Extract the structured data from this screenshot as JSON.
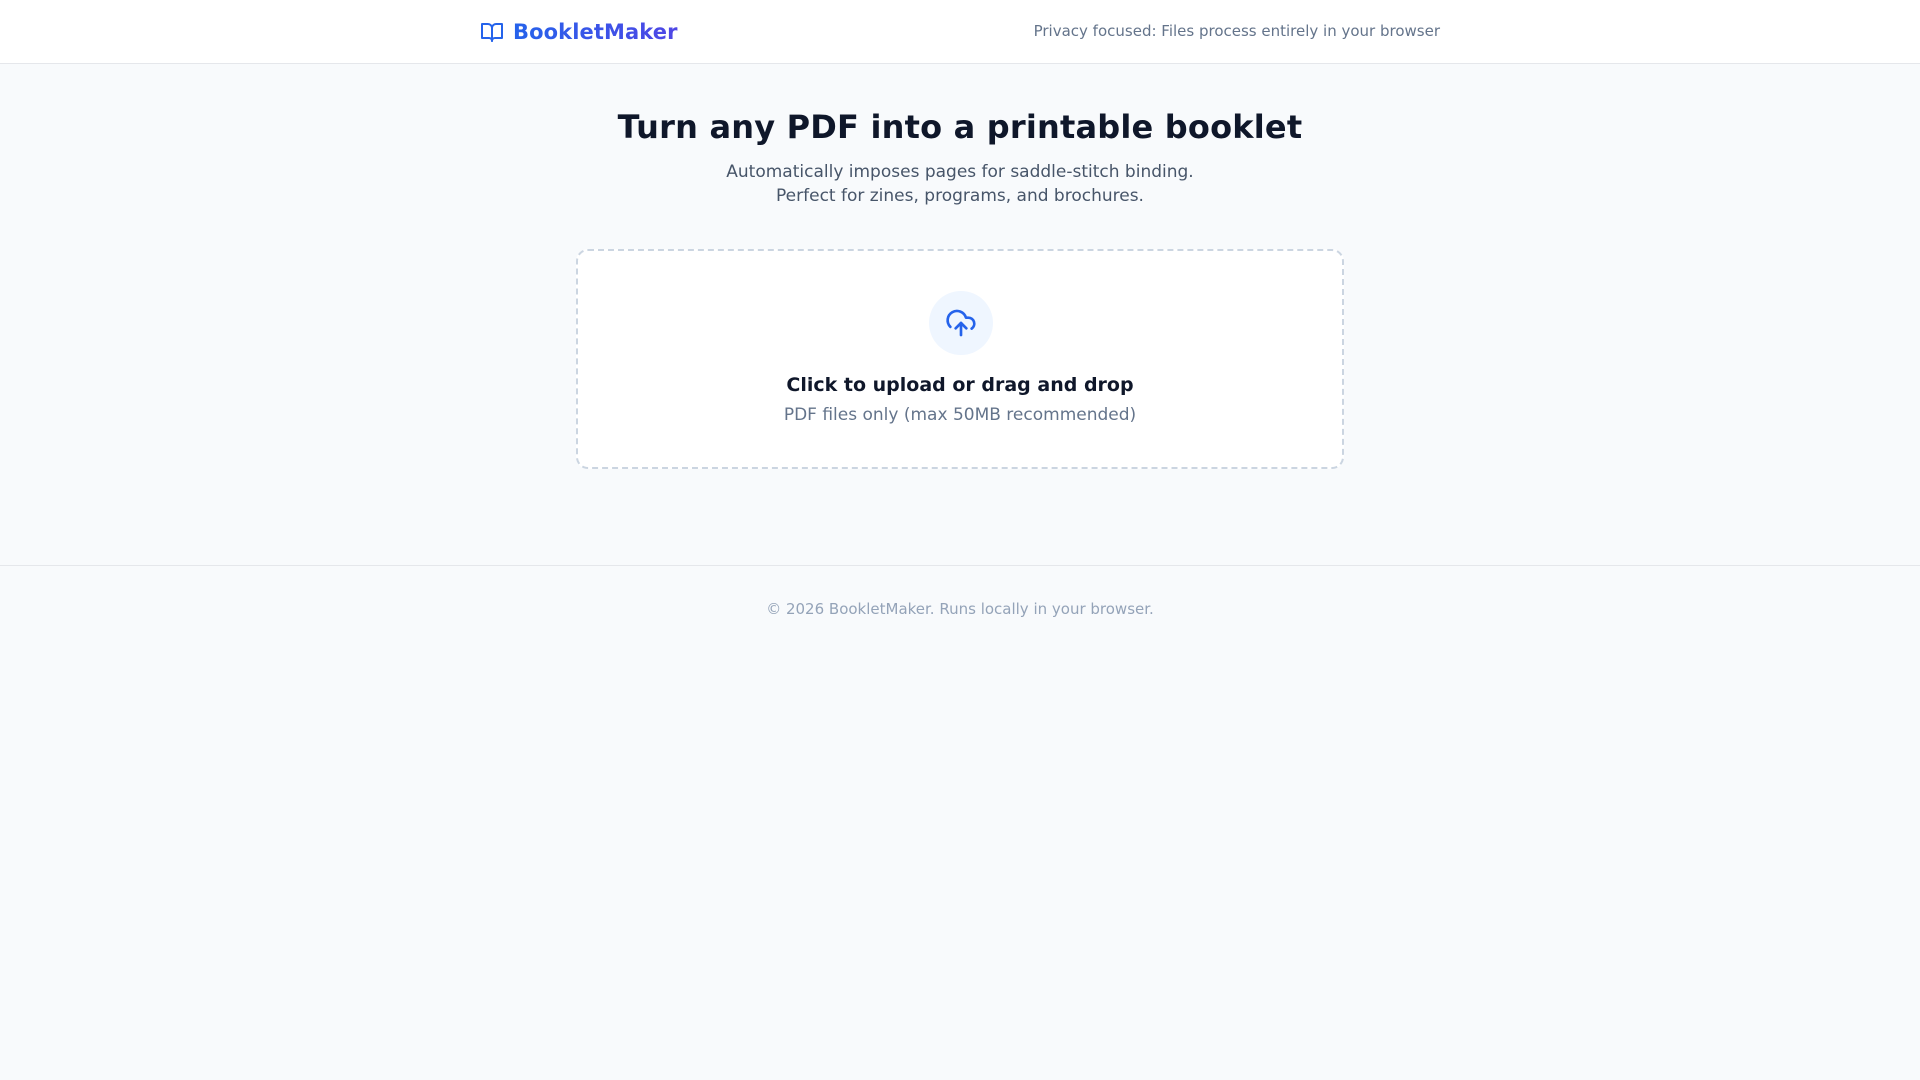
{
  "header": {
    "brand_icon": "book-open-icon",
    "brand_name": "BookletMaker",
    "privacy_note": "Privacy focused: Files process entirely in your browser"
  },
  "hero": {
    "title": "Turn any PDF into a printable booklet",
    "subtitle": "Automatically imposes pages for saddle-stitch binding. Perfect for zines, programs, and brochures."
  },
  "upload": {
    "icon": "upload-cloud-icon",
    "title": "Click to upload or drag and drop",
    "hint": "PDF files only (max 50MB recommended)"
  },
  "footer": {
    "text": "© 2026 BookletMaker. Runs locally in your browser."
  },
  "colors": {
    "brand_start": "#2563eb",
    "brand_end": "#4f46e5",
    "icon_blue": "#2563eb",
    "background": "#f8fafc"
  }
}
